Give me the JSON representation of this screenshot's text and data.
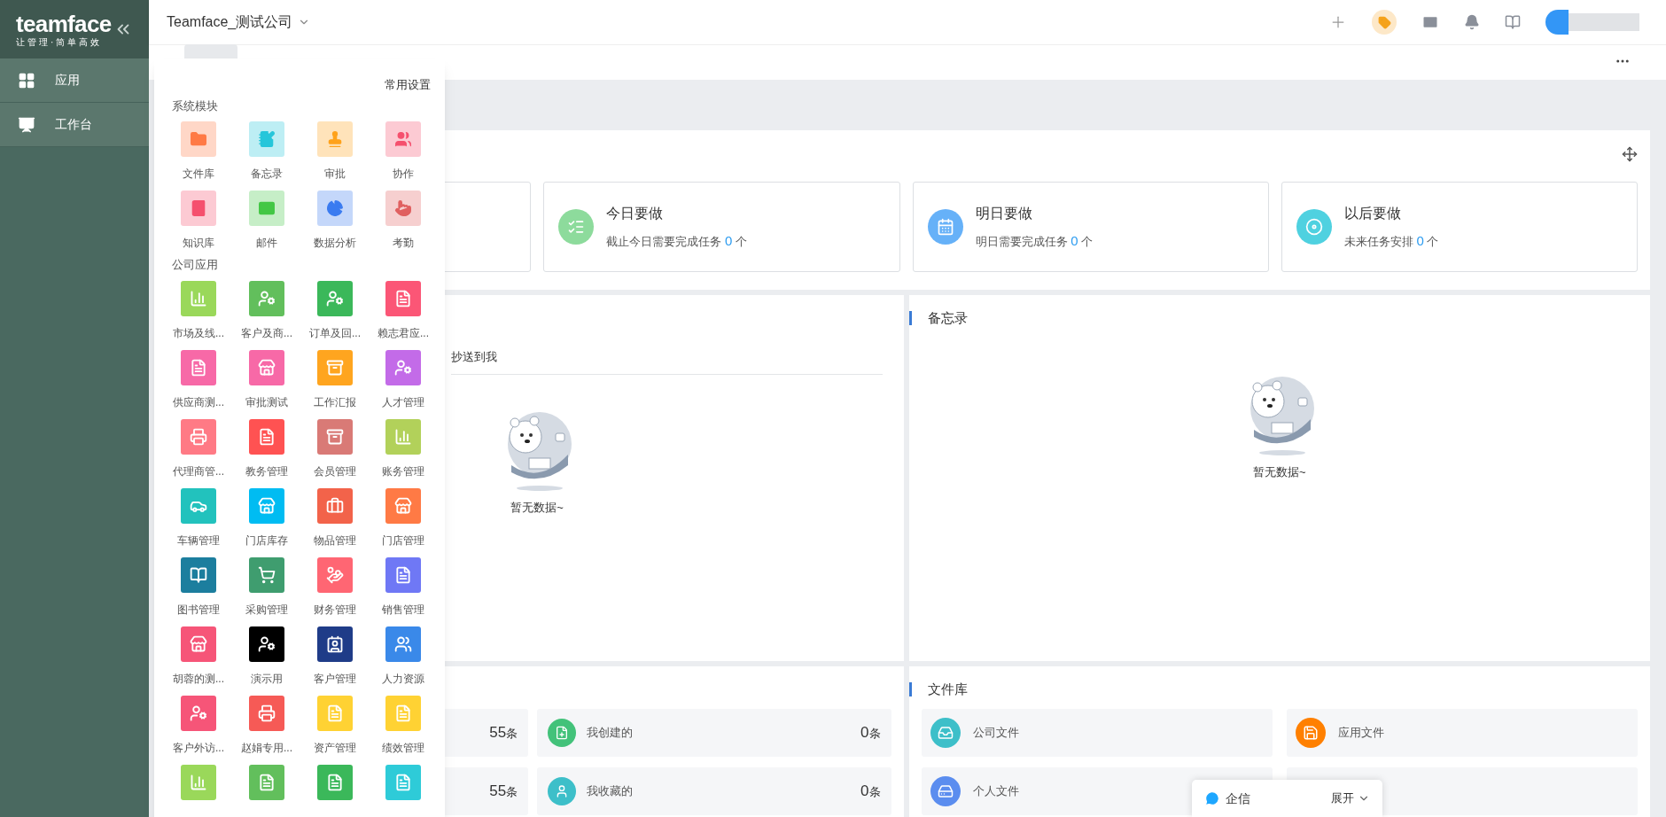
{
  "sidebar": {
    "logo": "teamface",
    "slogan": "让管理·简单高效",
    "items": [
      {
        "label": "应用"
      },
      {
        "label": "工作台"
      }
    ]
  },
  "header": {
    "company": "Teamface_测试公司"
  },
  "popup": {
    "settings_link": "常用设置",
    "sections": [
      {
        "title": "系统模块",
        "kind": "system",
        "apps": [
          {
            "label": "文件库",
            "color": "#ff7a45"
          },
          {
            "label": "备忘录",
            "color": "#26c6da"
          },
          {
            "label": "审批",
            "color": "#ffa21a"
          },
          {
            "label": "协作",
            "color": "#f5506e"
          },
          {
            "label": "知识库",
            "color": "#f5506e"
          },
          {
            "label": "邮件",
            "color": "#43c745"
          },
          {
            "label": "数据分析",
            "color": "#3a7bf0"
          },
          {
            "label": "考勤",
            "color": "#e06060"
          }
        ]
      },
      {
        "title": "公司应用",
        "kind": "company",
        "apps": [
          {
            "label": "市场及线...",
            "color": "#9ad85a"
          },
          {
            "label": "客户及商...",
            "color": "#62bf5c"
          },
          {
            "label": "订单及回...",
            "color": "#3bb85a"
          },
          {
            "label": "赖志君应...",
            "color": "#fb5676"
          },
          {
            "label": "供应商测...",
            "color": "#f769a7"
          },
          {
            "label": "审批测试",
            "color": "#f769a7"
          },
          {
            "label": "工作汇报",
            "color": "#ffa51f"
          },
          {
            "label": "人才管理",
            "color": "#c36be8"
          },
          {
            "label": "代理商管...",
            "color": "#ff7a85"
          },
          {
            "label": "教务管理",
            "color": "#ff5252"
          },
          {
            "label": "会员管理",
            "color": "#d97a76"
          },
          {
            "label": "账务管理",
            "color": "#b2d15a"
          },
          {
            "label": "车辆管理",
            "color": "#22c2bd"
          },
          {
            "label": "门店库存",
            "color": "#00bcf2"
          },
          {
            "label": "物品管理",
            "color": "#f2634a"
          },
          {
            "label": "门店管理",
            "color": "#ff7a45"
          },
          {
            "label": "图书管理",
            "color": "#1c7e9e"
          },
          {
            "label": "采购管理",
            "color": "#3f9d6f"
          },
          {
            "label": "财务管理",
            "color": "#ff6673"
          },
          {
            "label": "销售管理",
            "color": "#6f78f5"
          },
          {
            "label": "胡蓉的测...",
            "color": "#f65578"
          },
          {
            "label": "演示用",
            "color": "#000000"
          },
          {
            "label": "客户管理",
            "color": "#1f3c88"
          },
          {
            "label": "人力资源",
            "color": "#3a89e9"
          },
          {
            "label": "客户外访...",
            "color": "#f65578"
          },
          {
            "label": "赵娟专用...",
            "color": "#f65a56"
          },
          {
            "label": "资产管理",
            "color": "#ffd233"
          },
          {
            "label": "绩效管理",
            "color": "#ffd233"
          },
          {
            "color": "#9ad85a"
          },
          {
            "color": "#62bf5c"
          },
          {
            "color": "#3bb85a"
          },
          {
            "color": "#2ecbd8"
          }
        ]
      }
    ]
  },
  "task_cards": [
    {
      "title": "今日要做",
      "text_before": "截止今日需要完成任务",
      "count": "0",
      "text_after": "个",
      "color": "#8ddb9c"
    },
    {
      "title": "明日要做",
      "text_before": "明日需要完成任务",
      "count": "0",
      "text_after": "个",
      "color": "#66b1f8"
    },
    {
      "title": "以后要做",
      "text_before": "未来任务安排",
      "count": "0",
      "text_after": "个",
      "color": "#4fd1e0"
    }
  ],
  "approval_panel": {
    "tab": "抄送到我",
    "empty_text": "暂无数据~"
  },
  "memo_panel": {
    "title": "备忘录",
    "empty_text": "暂无数据~"
  },
  "records_panel": {
    "rows": [
      [
        {
          "count": "55",
          "unit": "条"
        },
        {
          "label": "我创建的",
          "count": "0",
          "unit": "条",
          "color": "#43c27a"
        }
      ],
      [
        {
          "count": "55",
          "unit": "条"
        },
        {
          "label": "我收藏的",
          "count": "0",
          "unit": "条",
          "color": "#3dbfc9"
        }
      ]
    ]
  },
  "files_panel": {
    "title": "文件库",
    "items": [
      {
        "label": "公司文件",
        "color": "#3dbfc9"
      },
      {
        "label": "应用文件",
        "color": "#ff8000"
      },
      {
        "label": "个人文件",
        "color": "#5b8def"
      }
    ]
  },
  "chat": {
    "label": "企信",
    "toggle": "展开"
  }
}
